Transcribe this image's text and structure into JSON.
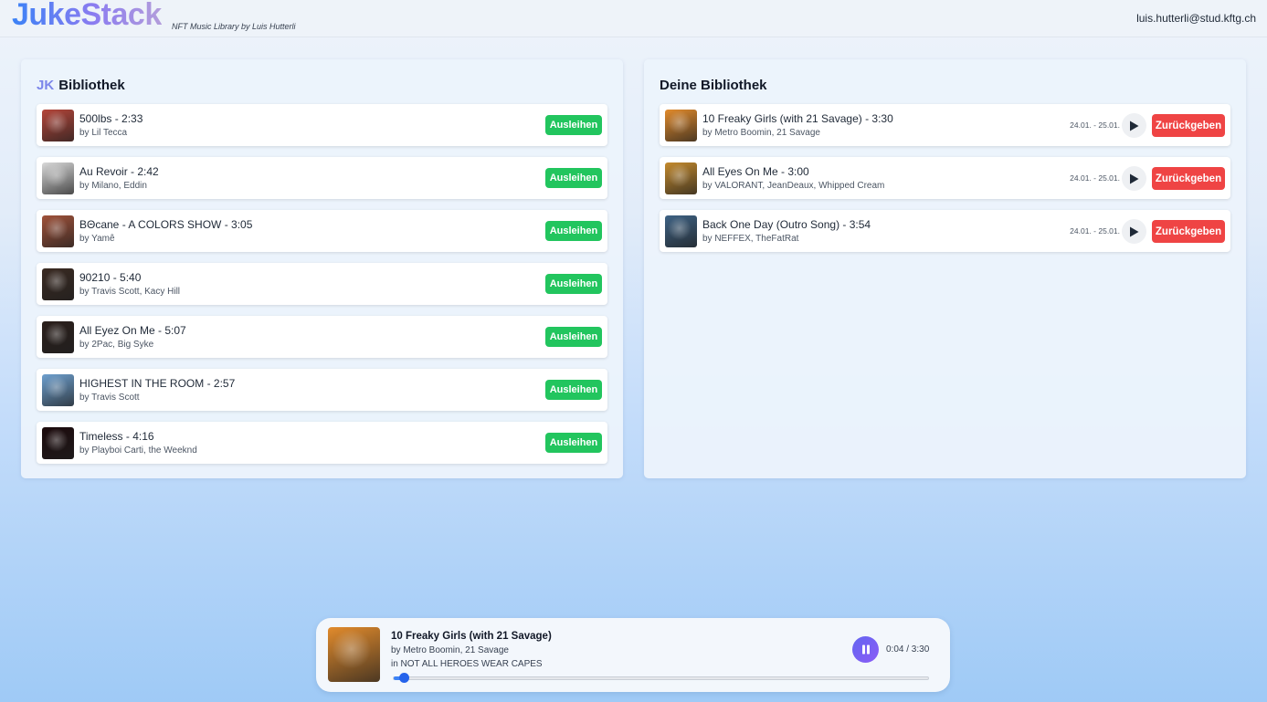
{
  "header": {
    "logo": "JukeStack",
    "tagline": "NFT Music Library by Luis Hutterli",
    "user_email": "luis.hutterli@stud.kftg.ch"
  },
  "library": {
    "prefix": "JK",
    "title": "Bibliothek",
    "borrow_label": "Ausleihen",
    "tracks": [
      {
        "title": "500lbs - 2:33",
        "artist": "by Lil Tecca",
        "cover_color": "#b5463a"
      },
      {
        "title": "Au Revoir - 2:42",
        "artist": "by Milano, Eddin",
        "cover_color": "#d9d9d9"
      },
      {
        "title": "BΘcane - A COLORS SHOW - 3:05",
        "artist": "by Yamê",
        "cover_color": "#a0523a"
      },
      {
        "title": "90210 - 5:40",
        "artist": "by Travis Scott, Kacy Hill",
        "cover_color": "#3a2a22"
      },
      {
        "title": "All Eyez On Me - 5:07",
        "artist": "by 2Pac, Big Syke",
        "cover_color": "#2b1f1b"
      },
      {
        "title": "HIGHEST IN THE ROOM - 2:57",
        "artist": "by Travis Scott",
        "cover_color": "#6ea0cf"
      },
      {
        "title": "Timeless - 4:16",
        "artist": "by Playboi Carti, the Weeknd",
        "cover_color": "#1c0a0c"
      }
    ]
  },
  "user_library": {
    "title": "Deine Bibliothek",
    "return_label": "Zurückgeben",
    "tracks": [
      {
        "title": "10 Freaky Girls (with 21 Savage) - 3:30",
        "artist": "by Metro Boomin, 21 Savage",
        "dates": "24.01. - 25.01.",
        "cover_color": "#e28b2c"
      },
      {
        "title": "All Eyes On Me - 3:00",
        "artist": "by VALORANT, JeanDeaux, Whipped Cream",
        "dates": "24.01. - 25.01.",
        "cover_color": "#c48a2d"
      },
      {
        "title": "Back One Day (Outro Song) - 3:54",
        "artist": "by NEFFEX, TheFatRat",
        "dates": "24.01. - 25.01.",
        "cover_color": "#3e6284"
      }
    ]
  },
  "player": {
    "title": "10 Freaky Girls (with 21 Savage)",
    "artist": "by Metro Boomin, 21 Savage",
    "album": "in NOT ALL HEROES WEAR CAPES",
    "time": "0:04 / 3:30",
    "progress": 0.019,
    "state": "playing",
    "accent": "#3b82f6"
  },
  "icons": {
    "play": "play-icon",
    "pause": "pause-icon"
  }
}
